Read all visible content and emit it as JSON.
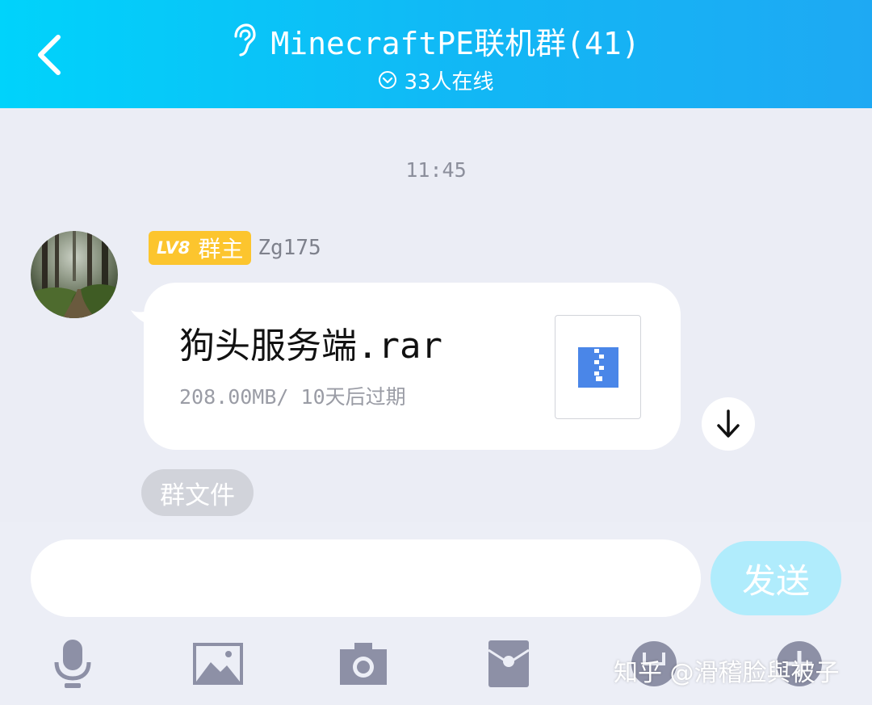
{
  "header": {
    "back_icon": "chevron-left-icon",
    "listen_icon": "ear-icon",
    "title": "MinecraftPE联机群(41)",
    "online_icon": "circle-chevron-down-icon",
    "online_text": "33人在线"
  },
  "chat": {
    "timestamp": "11:45",
    "message": {
      "sender": {
        "level": "LV8",
        "role": "群主",
        "name": "Zg175"
      },
      "file": {
        "name": "狗头服务端.rar",
        "meta": "208.00MB/ 10天后过期",
        "icon": "zip-file-icon"
      },
      "download_icon": "download-arrow-icon",
      "tag": "群文件"
    }
  },
  "input": {
    "placeholder": "",
    "send_label": "发送"
  },
  "toolbar": {
    "icons": [
      "microphone-icon",
      "image-icon",
      "camera-icon",
      "red-packet-icon",
      "emoji-icon",
      "plus-icon"
    ]
  },
  "watermark": "知乎 @滑稽脸與被子",
  "colors": {
    "header_gradient_start": "#00d3fb",
    "header_gradient_end": "#1ea9f3",
    "badge": "#fcc52e",
    "send_button": "#b0ecfc",
    "toolbar_icon": "#8d90a6",
    "zip_blue": "#4a86e8"
  }
}
